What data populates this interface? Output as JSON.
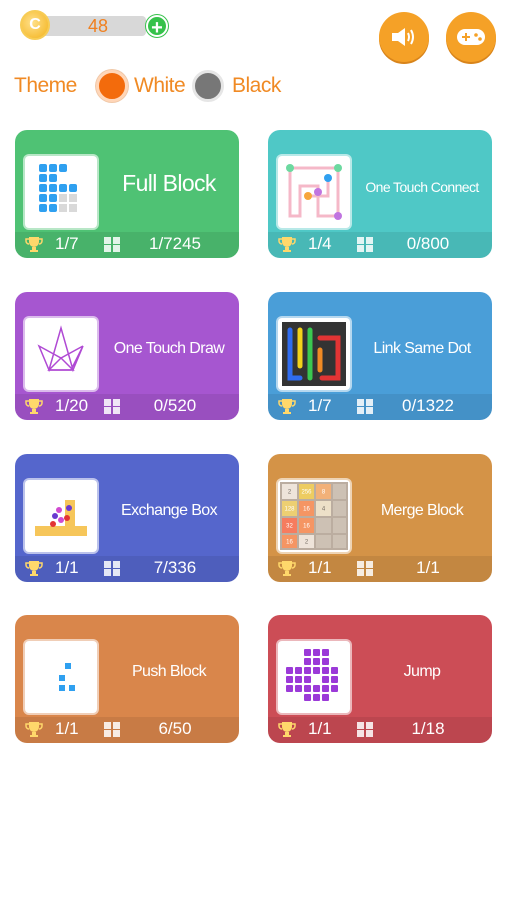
{
  "coins": {
    "count": "48",
    "symbol": "C",
    "add": "+"
  },
  "theme": {
    "label": "Theme",
    "options": [
      "White",
      "Black"
    ],
    "selected": "White"
  },
  "icons": {
    "sound": "speaker-icon",
    "games": "gamepad-icon"
  },
  "colors": {
    "accent": "#f5a127",
    "text_orange": "#f08a24"
  },
  "games": [
    {
      "title": "Full Block",
      "stat1": "1/7",
      "stat2": "1/7245",
      "color": "#4fc274"
    },
    {
      "title": "One Touch Connect",
      "stat1": "1/4",
      "stat2": "0/800",
      "color": "#4fc8c6"
    },
    {
      "title": "One Touch Draw",
      "stat1": "1/20",
      "stat2": "0/520",
      "color": "#a656d0"
    },
    {
      "title": "Link Same Dot",
      "stat1": "1/7",
      "stat2": "0/1322",
      "color": "#4a9ed8"
    },
    {
      "title": "Exchange Box",
      "stat1": "1/1",
      "stat2": "7/336",
      "color": "#5566cc"
    },
    {
      "title": "Merge Block",
      "stat1": "1/1",
      "stat2": "1/1",
      "color": "#d49347"
    },
    {
      "title": "Push Block",
      "stat1": "1/1",
      "stat2": "6/50",
      "color": "#d9864b"
    },
    {
      "title": "Jump",
      "stat1": "1/1",
      "stat2": "1/18",
      "color": "#cc4d56"
    }
  ],
  "merge_preview": [
    "2",
    "256",
    "8",
    "128",
    "16",
    "4",
    "32",
    "16",
    "16",
    "2"
  ]
}
